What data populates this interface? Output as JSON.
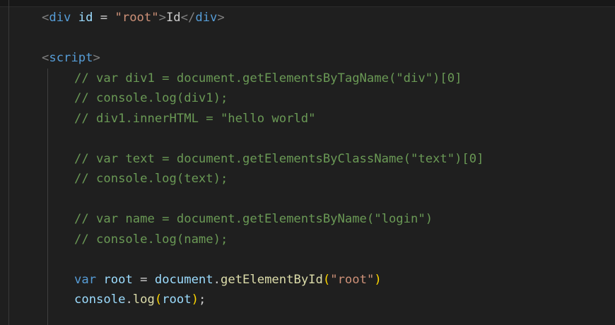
{
  "colors": {
    "background": "#1f1f1f",
    "tag": "#569cd6",
    "bracket": "#808080",
    "attribute": "#9cdcfe",
    "string": "#ce9178",
    "comment": "#6a9955",
    "keyword": "#569cd6",
    "variable": "#9cdcfe",
    "function": "#dcdcaa",
    "paren": "#ffd700",
    "text": "#cccccc"
  },
  "code": {
    "line_div": {
      "open_lt": "<",
      "tag": "div",
      "attr": " id",
      "eq": " = ",
      "value": "\"root\"",
      "open_gt": ">",
      "content": "Id",
      "close_lt": "</",
      "close_tag": "div",
      "close_gt": ">"
    },
    "line_script": {
      "lt": "<",
      "tag": "script",
      "gt": ">"
    },
    "comments": [
      "// var div1 = document.getElementsByTagName(\"div\")[0]",
      "// console.log(div1);",
      "// div1.innerHTML = \"hello world\"",
      "// var text = document.getElementsByClassName(\"text\")[0]",
      "// console.log(text);",
      "// var name = document.getElementsByName(\"login\")",
      "// console.log(name);"
    ],
    "line_var_root": {
      "keyword": "var",
      "var_name": " root",
      "eq": " = ",
      "object": "document",
      "dot": ".",
      "method": "getElementById",
      "open_paren": "(",
      "arg": "\"root\"",
      "close_paren": ")"
    },
    "line_console": {
      "object": "console",
      "dot": ".",
      "method": "log",
      "open_paren": "(",
      "arg": "root",
      "close_paren": ")",
      "semicolon": ";"
    }
  }
}
